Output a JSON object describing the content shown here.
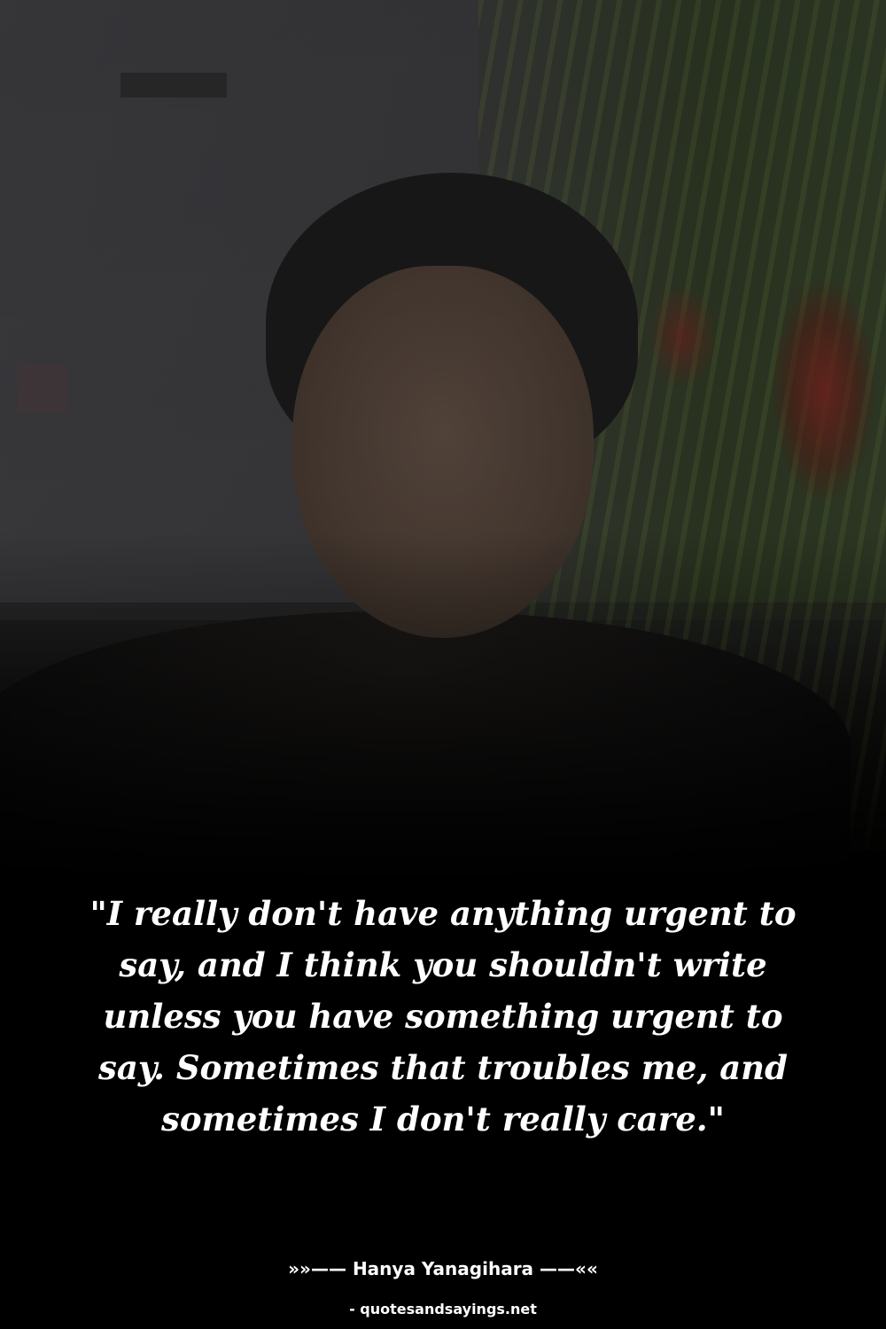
{
  "quote": {
    "text": "\"I really don't have anything urgent to say, and I think you shouldn't write unless you have something urgent to say. Sometimes that troubles me, and sometimes I don't really care.\"",
    "author_line": "»»—— Hanya Yanagihara ——««"
  },
  "footer": {
    "site": "- quotesandsayings.net"
  },
  "colors": {
    "background": "#000000",
    "text": "#ffffff"
  }
}
